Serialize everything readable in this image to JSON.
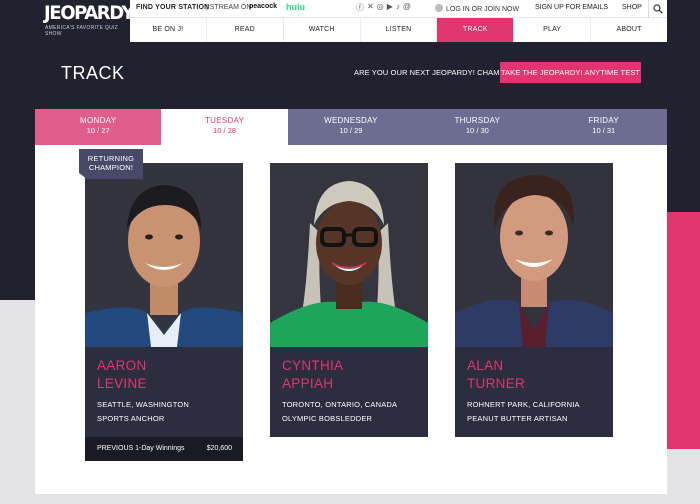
{
  "header": {
    "logo": "JEOPARDY!",
    "tagline": "AMERICA'S FAVORITE QUIZ SHOW",
    "find_station": "FIND YOUR STATION",
    "stream_on": "| STREAM ON",
    "peacock": "peacock",
    "hulu": "hulu",
    "social_icons": [
      "facebook-icon",
      "x-icon",
      "instagram-icon",
      "youtube-icon",
      "tiktok-icon",
      "threads-icon"
    ],
    "login": "LOG IN OR JOIN NOW",
    "signup": "SIGN UP FOR EMAILS",
    "shop": "SHOP"
  },
  "nav": {
    "items": [
      {
        "label": "BE ON J!",
        "active": false
      },
      {
        "label": "READ",
        "active": false
      },
      {
        "label": "WATCH",
        "active": false
      },
      {
        "label": "LISTEN",
        "active": false
      },
      {
        "label": "TRACK",
        "active": true
      },
      {
        "label": "PLAY",
        "active": false
      },
      {
        "label": "ABOUT",
        "active": false
      }
    ]
  },
  "page": {
    "title": "TRACK",
    "promo_question": "ARE YOU OUR NEXT JEOPARDY! CHAMPION?",
    "promo_button": "TAKE THE JEOPARDY! ANYTIME TEST"
  },
  "days": [
    {
      "day": "MONDAY",
      "date": "10 / 27"
    },
    {
      "day": "TUESDAY",
      "date": "10 / 28"
    },
    {
      "day": "WEDNESDAY",
      "date": "10 / 29"
    },
    {
      "day": "THURSDAY",
      "date": "10 / 30"
    },
    {
      "day": "FRIDAY",
      "date": "10 / 31"
    }
  ],
  "badge": "RETURNING CHAMPION!",
  "contestants": [
    {
      "first": "AARON",
      "last": "LEVINE",
      "location": "SEATTLE, WASHINGTON",
      "occupation": "SPORTS ANCHOR",
      "winnings_label": "PREVIOUS 1-Day Winnings",
      "winnings_value": "$20,600"
    },
    {
      "first": "CYNTHIA",
      "last": "APPIAH",
      "location": "TORONTO, ONTARIO, CANADA",
      "occupation": "OLYMPIC BOBSLEDDER"
    },
    {
      "first": "ALAN",
      "last": "TURNER",
      "location": "ROHNERT PARK, CALIFORNIA",
      "occupation": "PEANUT BUTTER ARTISAN"
    }
  ],
  "colors": {
    "accent": "#e0356e",
    "dark_bg": "#21212f",
    "card_bg": "#2c2d3e",
    "tab_inactive": "#6c6d90"
  }
}
